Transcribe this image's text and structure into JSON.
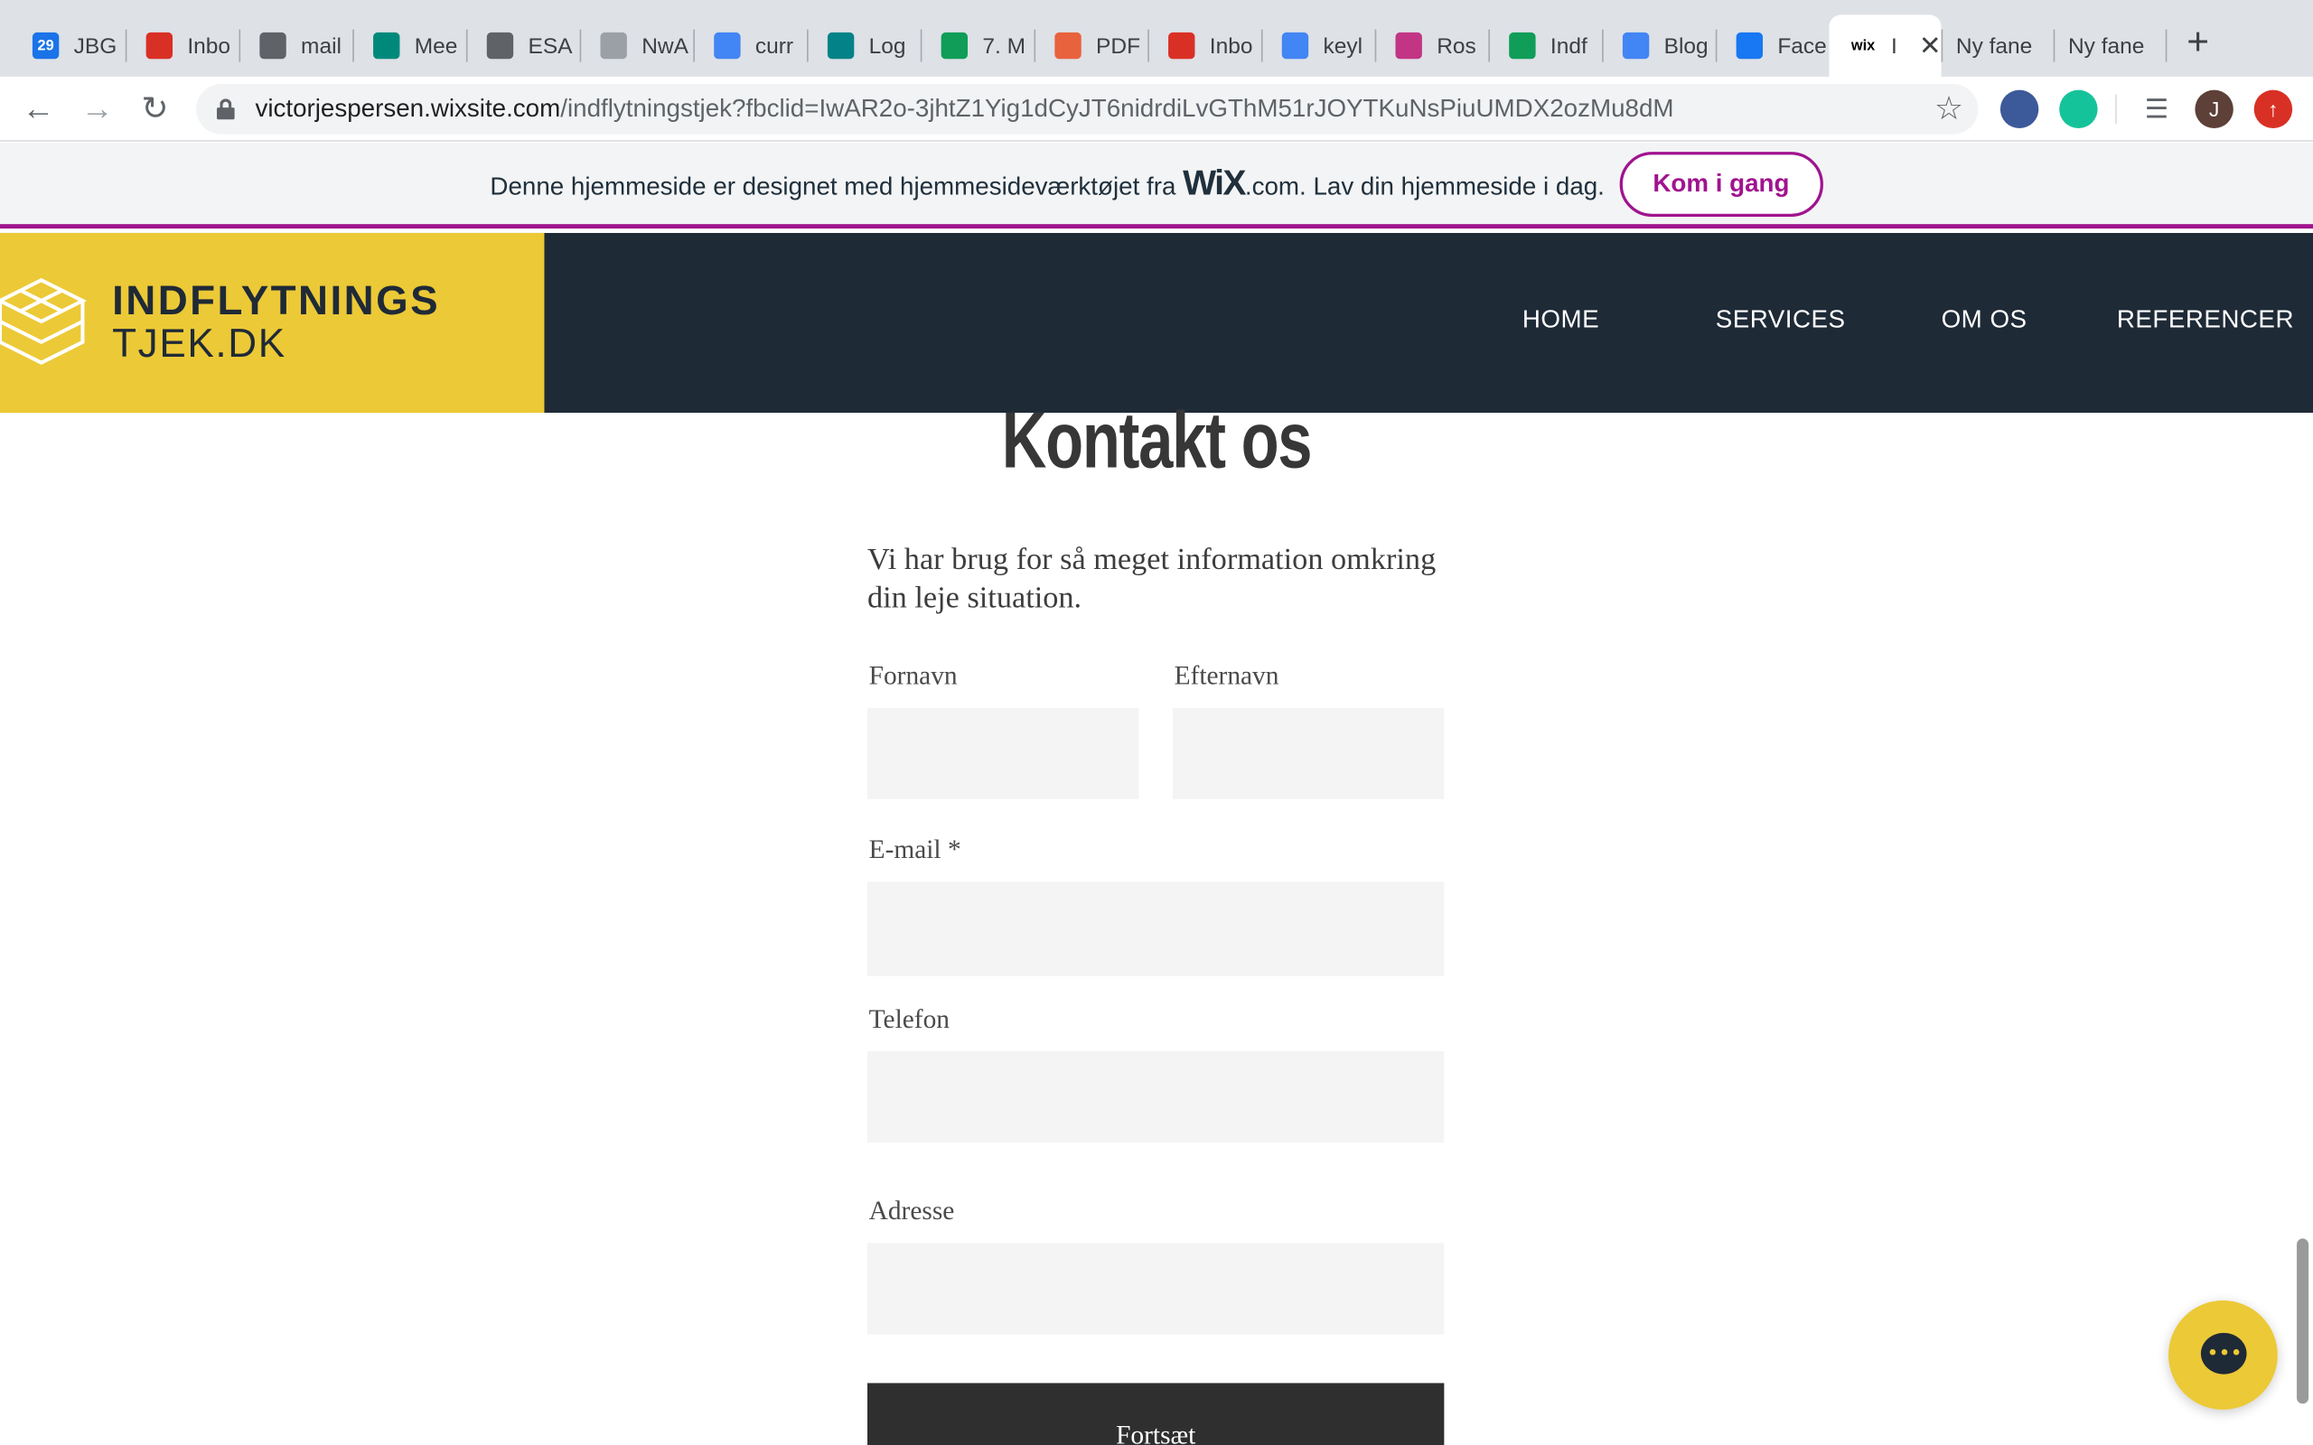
{
  "browser": {
    "tabs": [
      {
        "title": "JBG",
        "favicon": "calendar-icon",
        "color": "#1a73e8",
        "badge": "29"
      },
      {
        "title": "Inbo",
        "favicon": "gmail-icon",
        "color": "#d93025"
      },
      {
        "title": "mail",
        "favicon": "globe-icon",
        "color": "#5f6368"
      },
      {
        "title": "Mee",
        "favicon": "meet-icon",
        "color": "#00897b"
      },
      {
        "title": "ESA",
        "favicon": "globe-icon",
        "color": "#5f6368"
      },
      {
        "title": "NwA",
        "favicon": "document-icon",
        "color": "#9aa0a6"
      },
      {
        "title": "curr",
        "favicon": "google-icon",
        "color": "#4285f4"
      },
      {
        "title": "Log",
        "favicon": "sharepoint-icon",
        "color": "#038387"
      },
      {
        "title": "7. M",
        "favicon": "drive-icon",
        "color": "#0f9d58"
      },
      {
        "title": "PDF",
        "favicon": "pdf-icon",
        "color": "#e8623d"
      },
      {
        "title": "Inbo",
        "favicon": "gmail-icon",
        "color": "#d93025"
      },
      {
        "title": "keyl",
        "favicon": "google-icon",
        "color": "#4285f4"
      },
      {
        "title": "Ros",
        "favicon": "instagram-icon",
        "color": "#c13584"
      },
      {
        "title": "Indf",
        "favicon": "drive-icon",
        "color": "#0f9d58"
      },
      {
        "title": "Blog",
        "favicon": "docs-icon",
        "color": "#4285f4"
      },
      {
        "title": "Face",
        "favicon": "facebook-icon",
        "color": "#1877f2"
      },
      {
        "title": "I",
        "favicon": "wix-icon",
        "color": "#000000",
        "active": true
      },
      {
        "title": "Ny fane",
        "favicon": "",
        "color": ""
      },
      {
        "title": "Ny fane",
        "favicon": "",
        "color": ""
      }
    ],
    "url_host": "victorjespersen.wixsite.com",
    "url_path": "/indflytningstjek?fbclid=IwAR2o-3jhtZ1Yig1dCyJT6nidrdiLvGThM51rJOYTKuNsPiuUMDX2ozMu8dM",
    "profile_initial": "J"
  },
  "wix_banner": {
    "text_before": "Denne hjemmeside er designet med hjemmesideværktøjet fra ",
    "wix_logo": "WiX",
    "text_after": ".com. Lav din hjemmeside i dag.",
    "cta": "Kom i gang"
  },
  "site": {
    "logo_line1": "INDFLYTNINGS",
    "logo_line2": "TJEK.DK",
    "nav": [
      "HOME",
      "SERVICES",
      "OM OS",
      "REFERENCER"
    ],
    "colors": {
      "brand_yellow": "#ecc936",
      "header_dark": "#1f2a37",
      "wix_purple": "#a0138e"
    }
  },
  "form": {
    "title": "Kontakt os",
    "intro": "Vi har brug for så meget information omkring din leje situation.",
    "first_name_label": "Fornavn",
    "last_name_label": "Efternavn",
    "email_label": "E-mail *",
    "phone_label": "Telefon",
    "address_label": "Adresse",
    "submit_label": "Fortsæt"
  }
}
